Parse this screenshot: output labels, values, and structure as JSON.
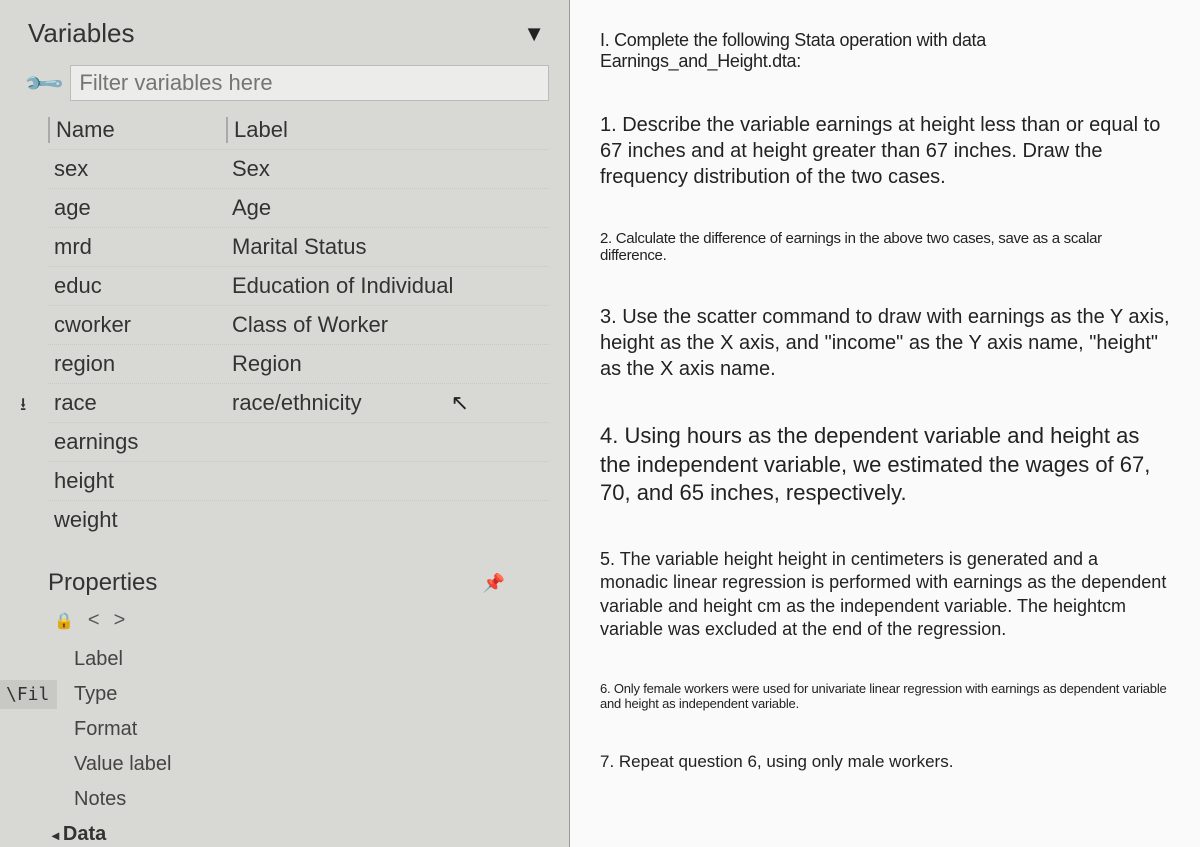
{
  "leftPanel": {
    "title": "Variables",
    "filterPlaceholder": "Filter variables here",
    "columns": {
      "name": "Name",
      "label": "Label"
    },
    "variables": [
      {
        "name": "sex",
        "label": "Sex"
      },
      {
        "name": "age",
        "label": "Age"
      },
      {
        "name": "mrd",
        "label": "Marital Status"
      },
      {
        "name": "educ",
        "label": "Education of Individual"
      },
      {
        "name": "cworker",
        "label": "Class of Worker"
      },
      {
        "name": "region",
        "label": "Region"
      },
      {
        "name": "race",
        "label": "race/ethnicity",
        "marked": true,
        "cursor": true
      },
      {
        "name": "earnings",
        "label": ""
      },
      {
        "name": "height",
        "label": ""
      },
      {
        "name": "weight",
        "label": ""
      }
    ],
    "properties": {
      "title": "Properties",
      "items": [
        "Label",
        "Type",
        "Format",
        "Value label",
        "Notes"
      ],
      "dataToggle": "Data"
    },
    "sideTab": "\\Fil"
  },
  "rightPanel": {
    "heading": "I. Complete the following Stata operation with data Earnings_and_Height.dta:",
    "q1": "1. Describe the variable earnings at height less than or equal to 67 inches and at height greater than 67 inches. Draw the frequency distribution of the two cases.",
    "q2": "2. Calculate the difference of earnings in the above two cases, save as a scalar difference.",
    "q3": "3. Use the scatter command to draw with earnings as the Y axis, height as the X axis, and \"income\" as the Y axis name, \"height\" as the X axis name.",
    "q4": "4. Using hours as the dependent variable and height as the independent variable, we estimated the wages of 67, 70, and 65 inches, respectively.",
    "q5": "5. The variable height height in centimeters is generated and a monadic linear regression is performed with earnings as the dependent variable and height cm as the independent variable. The heightcm variable was excluded at the end of the regression.",
    "q6": "6. Only female workers were used for univariate linear regression with earnings as dependent variable and height as independent variable.",
    "q7": "7. Repeat question 6, using only male workers."
  }
}
